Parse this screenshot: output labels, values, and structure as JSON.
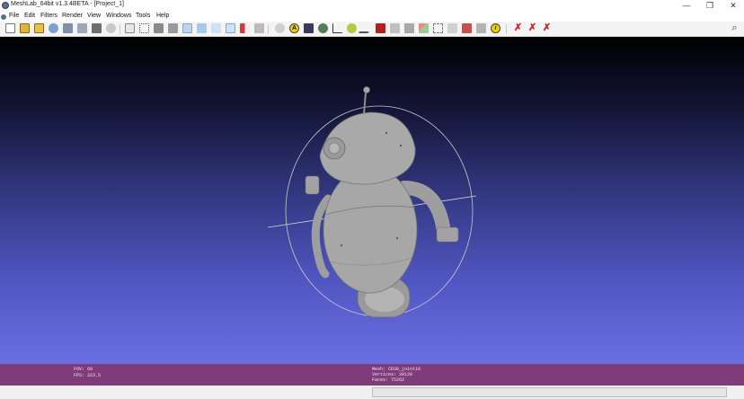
{
  "window": {
    "title": "MeshLab_64bit v1.3.4BETA - [Project_1]",
    "minimize_glyph": "—",
    "maximize_glyph": "❐",
    "close_glyph": "✕"
  },
  "menu": [
    "File",
    "Edit",
    "Filters",
    "Render",
    "View",
    "Windows",
    "Tools",
    "Help"
  ],
  "toolbar": {
    "info_glyph": "i",
    "font_glyph": "A",
    "search_glyph": "⌕"
  },
  "info": {
    "fov": "FOV: 60",
    "fps": "FPS:   323.5",
    "mesh": "Mesh: CD30_joint18",
    "vertices": "Vertices: 39128",
    "faces": "Faces: 75262"
  },
  "colors": {
    "info_bar": "#803c7a",
    "viewport_bottom": "#6a6fe0",
    "mesh": "#a7a7a7",
    "trackball": "#c8c8c8"
  }
}
